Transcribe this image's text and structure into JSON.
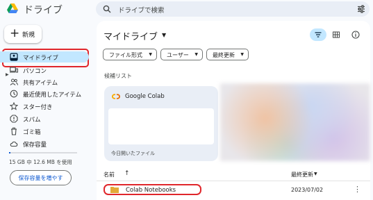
{
  "app": {
    "title": "ドライブ"
  },
  "search": {
    "placeholder": "ドライブで検索"
  },
  "sidebar": {
    "new_label": "新規",
    "items": [
      {
        "label": "マイドライブ",
        "icon": "my-drive-icon"
      },
      {
        "label": "パソコン",
        "icon": "computers-icon"
      },
      {
        "label": "共有アイテム",
        "icon": "shared-icon"
      },
      {
        "label": "最近使用したアイテム",
        "icon": "clock-icon"
      },
      {
        "label": "スター付き",
        "icon": "star-icon"
      },
      {
        "label": "スパム",
        "icon": "spam-icon"
      },
      {
        "label": "ゴミ箱",
        "icon": "trash-icon"
      },
      {
        "label": "保存容量",
        "icon": "cloud-icon"
      }
    ],
    "storage_text": "15 GB 中 12.6 MB を使用",
    "storage_used_fraction": 0.0008,
    "get_storage_label": "保存容量を増やす"
  },
  "main": {
    "title": "マイドライブ",
    "filters": [
      "ファイル形式",
      "ユーザー",
      "最終更新"
    ],
    "suggested_label": "候補リスト",
    "card": {
      "title": "Google Colab",
      "reason": "今日開いたファイル"
    },
    "columns": {
      "name": "名前",
      "modified": "最終更新"
    },
    "rows": [
      {
        "name": "Colab Notebooks",
        "modified": "2023/07/02"
      }
    ]
  },
  "colors": {
    "accent": "#0b57d0",
    "selected": "#c2e7ff",
    "highlight": "#e0262b",
    "folder": "#e3a937"
  }
}
